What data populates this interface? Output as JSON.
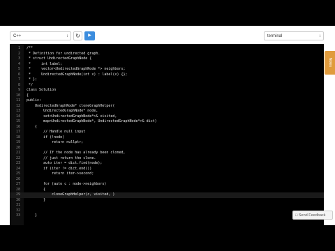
{
  "toolbar": {
    "language": "C++",
    "reset_icon": "refresh-icon",
    "run_icon": "play-icon",
    "run_label": "▶",
    "reset_label": "↻",
    "console_mode": "terminal"
  },
  "side_tab": {
    "label": "Notes"
  },
  "feedback": {
    "label": "Send Feedback",
    "icon": "comment-icon"
  },
  "colors": {
    "comment": "#ff4f4f",
    "keyword": "#f56a4b",
    "run_button": "#3c8dde",
    "side_tab": "#e09b3d"
  },
  "code_lines": [
    {
      "n": "1",
      "t": "/**",
      "c": "cm"
    },
    {
      "n": "2",
      "t": " * Definition for undirected graph.",
      "c": "cm"
    },
    {
      "n": "3",
      "t": " * struct UndirectedGraphNode {",
      "c": "cm"
    },
    {
      "n": "4",
      "t": " *     int label;",
      "c": "cm"
    },
    {
      "n": "5",
      "t": " *     vector<UndirectedGraphNode *> neighbors;",
      "c": "cm"
    },
    {
      "n": "6",
      "t": " *     UndirectedGraphNode(int x) : label(x) {};",
      "c": "cm"
    },
    {
      "n": "7",
      "t": " * };",
      "c": "cm"
    },
    {
      "n": "8",
      "t": " */",
      "c": "cm"
    },
    {
      "n": "9",
      "t": "class Solution",
      "c": "kw"
    },
    {
      "n": "10",
      "t": "{",
      "c": ""
    },
    {
      "n": "11",
      "t": "public:",
      "c": "kw"
    },
    {
      "n": "12",
      "t": "    UndirectedGraphNode* cloneGraphHelper(",
      "c": ""
    },
    {
      "n": "13",
      "t": "        UndirectedGraphNode* node,",
      "c": ""
    },
    {
      "n": "14",
      "t": "        set<UndirectedGraphNode*>& visited,",
      "c": ""
    },
    {
      "n": "15",
      "t": "        map<UndirectedGraphNode*, UndirectedGraphNode*>& dict)",
      "c": ""
    },
    {
      "n": "16",
      "t": "    {",
      "c": ""
    },
    {
      "n": "17",
      "t": "        // Handle null input",
      "c": "cm"
    },
    {
      "n": "18",
      "t": "        if (!node)",
      "c": "kw"
    },
    {
      "n": "19",
      "t": "            return nullptr;",
      "c": "kw"
    },
    {
      "n": "20",
      "t": "",
      "c": ""
    },
    {
      "n": "21",
      "t": "        // If the node has already been cloned,",
      "c": "cm"
    },
    {
      "n": "22",
      "t": "        // just return the clone.",
      "c": "cm"
    },
    {
      "n": "23",
      "t": "        auto iter = dict.find(node);",
      "c": ""
    },
    {
      "n": "24",
      "t": "        if (iter != dict.end())",
      "c": ""
    },
    {
      "n": "25",
      "t": "            return iter->second;",
      "c": ""
    },
    {
      "n": "26",
      "t": "",
      "c": ""
    },
    {
      "n": "27",
      "t": "        for (auto c : node->neighbors)",
      "c": ""
    },
    {
      "n": "28",
      "t": "        {",
      "c": ""
    },
    {
      "n": "29",
      "t": "            cloneGraphHelper(c, visited, )",
      "c": ""
    },
    {
      "n": "30",
      "t": "        }",
      "c": ""
    },
    {
      "n": "31",
      "t": "",
      "c": ""
    },
    {
      "n": "32",
      "t": "",
      "c": ""
    },
    {
      "n": "33",
      "t": "    }",
      "c": ""
    }
  ]
}
